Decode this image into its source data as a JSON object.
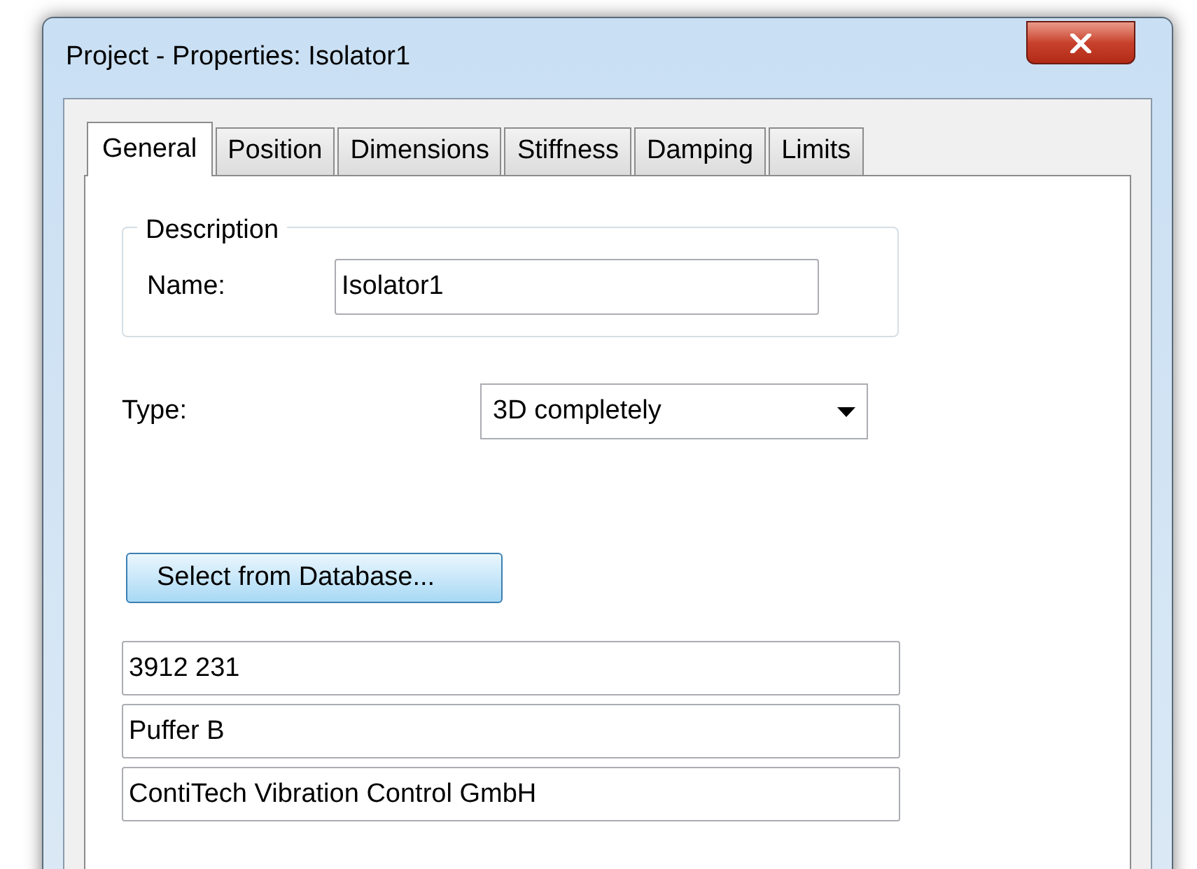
{
  "window": {
    "title": "Project - Properties: Isolator1"
  },
  "tabs": [
    {
      "label": "General",
      "selected": true
    },
    {
      "label": "Position",
      "selected": false
    },
    {
      "label": "Dimensions",
      "selected": false
    },
    {
      "label": "Stiffness",
      "selected": false
    },
    {
      "label": "Damping",
      "selected": false
    },
    {
      "label": "Limits",
      "selected": false
    }
  ],
  "description": {
    "legend": "Description",
    "name_label": "Name:",
    "name_value": "Isolator1"
  },
  "type": {
    "label": "Type:",
    "value": "3D completely"
  },
  "database_button": "Select from Database...",
  "fields": [
    {
      "value": "3912 231"
    },
    {
      "value": "Puffer B"
    },
    {
      "value": "ContiTech Vibration Control GmbH"
    }
  ]
}
